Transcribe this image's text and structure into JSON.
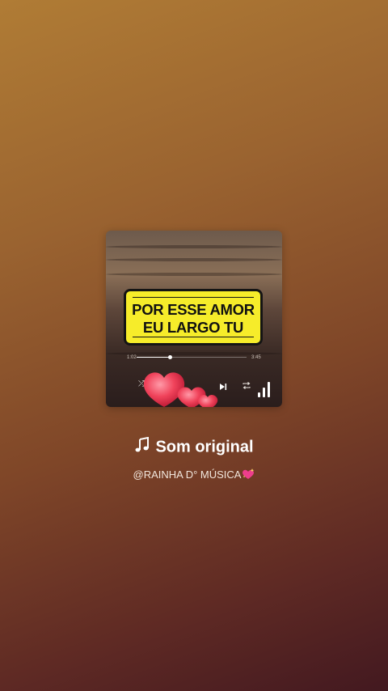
{
  "album": {
    "sign_line1": "POR ESSE AMOR",
    "sign_line2": "EU LARGO TU",
    "time_elapsed": "1:02",
    "time_total": "3:45",
    "progress": 0.3
  },
  "audio": {
    "title": "Som original",
    "author": "@RAINHA D° MÚSICA",
    "title_icon": "music-note-icon",
    "author_emoji": "sparkling-heart-icon"
  },
  "colors": {
    "sign_yellow": "#f6ec2a",
    "heart_red": "#f0435b"
  }
}
